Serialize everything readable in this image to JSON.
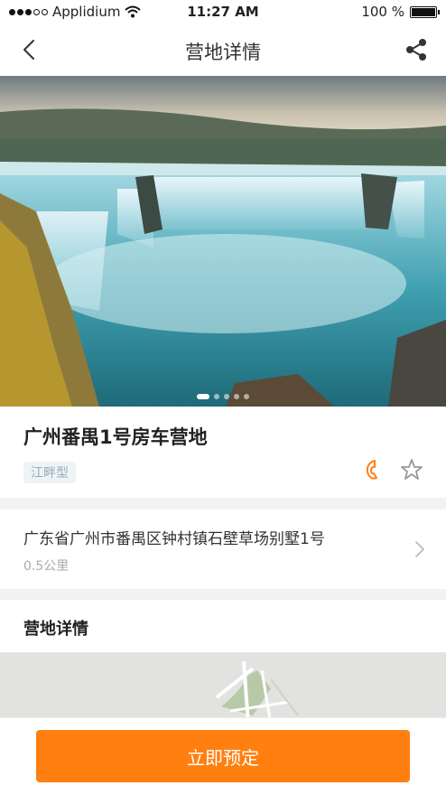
{
  "status_bar": {
    "carrier": "Applidium",
    "time": "11:27 AM",
    "battery": "100 %",
    "icons": [
      "signal-dots-icon",
      "wifi-icon",
      "battery-icon"
    ]
  },
  "nav": {
    "title": "营地详情",
    "back_icon": "chevron-left-icon",
    "share_icon": "share-icon"
  },
  "gallery": {
    "image": "waterfall-photo",
    "page_count": 5,
    "active_page": 1
  },
  "camp": {
    "name": "广州番禺1号房车营地",
    "tag": "江畔型",
    "phone_icon": "phone-icon",
    "favorite_icon": "star-outline-icon",
    "accent_color": "#ff7f11"
  },
  "address": {
    "text": "广东省广州市番禺区钟村镇石壁草场别墅1号",
    "distance": "0.5公里",
    "arrow_icon": "chevron-right-icon"
  },
  "details": {
    "title": "营地详情"
  },
  "action": {
    "book_label": "立即预定",
    "color": "#ff7f11"
  }
}
